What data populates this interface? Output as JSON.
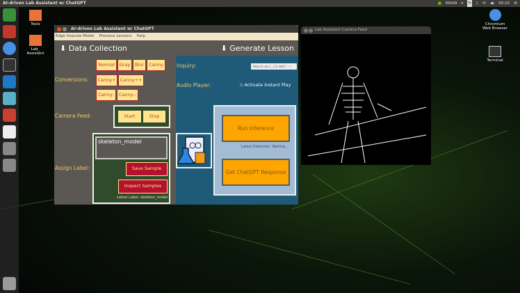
{
  "topbar": {
    "title": "AI-driven Lab Assistant w/ ChatGPT",
    "tray": [
      "MAXN",
      "Tr",
      "00:20"
    ]
  },
  "desktop": {
    "left_icons": [
      "Tools",
      "Lab_\nAssistant"
    ],
    "right_icons": [
      "Chromium Web Browser",
      "Terminal"
    ]
  },
  "app": {
    "title": "AI-driven Lab Assistant w/ ChatGPT",
    "menu": [
      "Edge Impulse Model",
      "Previous Lessons",
      "Help"
    ],
    "data_collection": {
      "heading": "⬇ Data Collection",
      "conversions_label": "Conversions:",
      "conversions": [
        "Normal",
        "Gray",
        "Blur",
        "Canny",
        "Canny+",
        "Canny++",
        "Canny-",
        "Canny--"
      ],
      "camera_feed_label": "Camera Feed:",
      "start": "Start",
      "stop": "Stop",
      "assign_label": "Assign Label:",
      "label_value": "skeleton_model",
      "save_sample": "Save Sample",
      "inspect_samples": "Inspect Samples",
      "latest_label": "Latest Label: skeleton_model"
    },
    "generate_lesson": {
      "heading": "⬇ Generate Lesson",
      "inquiry_label": "Inquiry:",
      "inquiry_value": "How to use [...] in labs?",
      "audio_label": "Audio Player:",
      "instant_play": "Activate Instant Play",
      "run_inference": "Run Inference",
      "latest_detection": "Latest Detection: Waiting...",
      "chatgpt": "Get ChatGPT Response"
    }
  },
  "camera": {
    "title": "Lab Assistant Camera Feed"
  },
  "colors": {
    "panel_blue": "#1f5a78",
    "accent_orange": "#ffa500",
    "button_red": "#b5102c"
  }
}
